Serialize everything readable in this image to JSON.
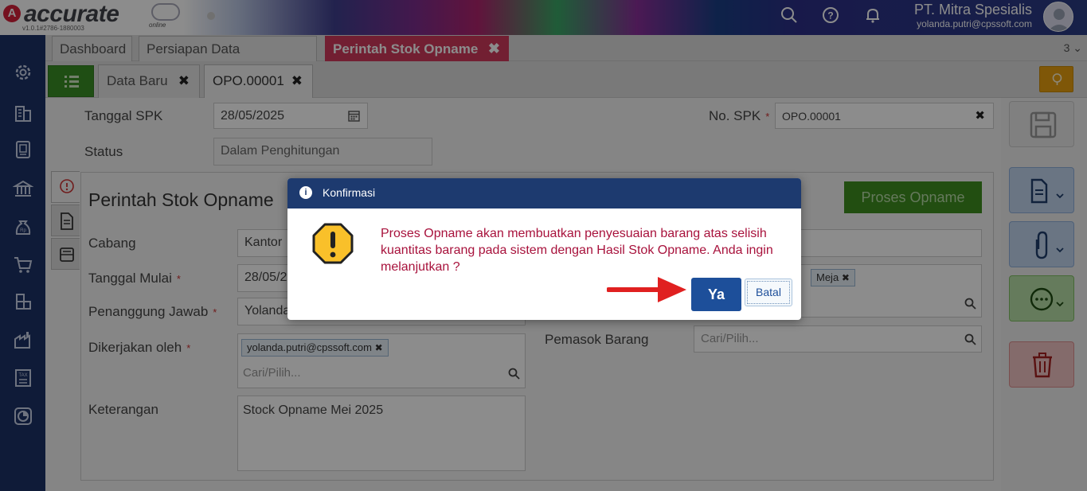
{
  "app": {
    "logo_text": "accurate",
    "logo_sub": "online",
    "version": "v1.0.1#2786-1880003",
    "company_name": "PT. Mitra Spesialis",
    "user_email": "yolanda.putri@cpssoft.com"
  },
  "tabs": [
    {
      "label": "Dashboard"
    },
    {
      "label": "Persiapan Data Perusahaan"
    },
    {
      "label": "Perintah Stok Opname",
      "close": "✖"
    }
  ],
  "tabs_count": "3 ⌄",
  "subtabs": [
    {
      "label": "Data Baru",
      "close": "✖"
    },
    {
      "label": "OPO.00001",
      "close": "✖"
    }
  ],
  "form": {
    "tanggal_spk_label": "Tanggal SPK",
    "tanggal_spk_value": "28/05/2025",
    "no_spk_label": "No. SPK",
    "no_spk_value": "OPO.00001",
    "status_label": "Status",
    "status_value": "Dalam Penghitungan",
    "required_mark": "*"
  },
  "panel": {
    "title": "Perintah Stok Opname",
    "proses_button": "Proses Opname",
    "cabang_label": "Cabang",
    "cabang_value": "Kantor",
    "tanggal_mulai_label": "Tanggal Mulai",
    "tanggal_mulai_value": "28/05/2",
    "penanggung_jawab_label": "Penanggung Jawab",
    "penanggung_jawab_value": "Yolanda",
    "dikerjakan_label": "Dikerjakan oleh",
    "dikerjakan_chip": "yolanda.putri@cpssoft.com",
    "search_placeholder": "Cari/Pilih...",
    "keterangan_label": "Keterangan",
    "keterangan_value": "Stock Opname Mei 2025",
    "meja_chip": "Meja",
    "pemasok_label": "Pemasok Barang",
    "pemasok_placeholder": "Cari/Pilih..."
  },
  "modal": {
    "title": "Konfirmasi",
    "info_icon_text": "i",
    "message": "Proses Opname akan membuatkan penyesuaian barang atas selisih kuantitas barang pada sistem dengan Hasil Stok Opname. Anda ingin melanjutkan ?",
    "yes_label": "Ya",
    "cancel_label": "Batal"
  },
  "colors": {
    "sidebar": "#1d3266",
    "active_tab": "#d03a5c",
    "modal_header": "#1d3a6f",
    "message_text": "#a8123c",
    "arrow": "#e02020"
  }
}
